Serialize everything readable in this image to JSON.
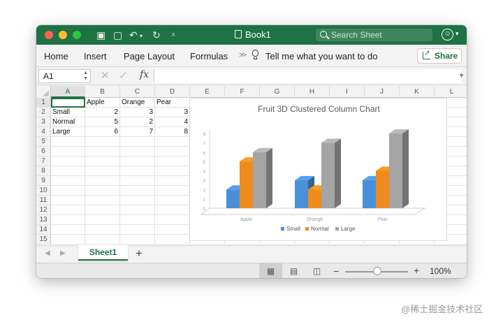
{
  "window": {
    "title": "Book1",
    "search_placeholder": "Search Sheet",
    "colors": {
      "accent": "#1f7244",
      "small": "#4a90d9",
      "normal": "#f08b1e",
      "large": "#a5a5a5"
    }
  },
  "ribbon": {
    "tabs": [
      "Home",
      "Insert",
      "Page Layout",
      "Formulas"
    ],
    "tell_me": "Tell me what you want to do",
    "share_label": "Share"
  },
  "formula_bar": {
    "name_box": "A1",
    "formula": "",
    "fx_label": "fx"
  },
  "columns": [
    "A",
    "B",
    "C",
    "D",
    "E",
    "F",
    "G",
    "H",
    "I",
    "J",
    "K",
    "L"
  ],
  "rows": [
    "1",
    "2",
    "3",
    "4",
    "5",
    "6",
    "7",
    "8",
    "9",
    "10",
    "11",
    "12",
    "13",
    "14",
    "15"
  ],
  "table": {
    "header": [
      "",
      "Apple",
      "Orange",
      "Pear"
    ],
    "rows": [
      [
        "Small",
        "2",
        "3",
        "3"
      ],
      [
        "Normal",
        "5",
        "2",
        "4"
      ],
      [
        "Large",
        "6",
        "7",
        "8"
      ]
    ]
  },
  "chart_data": {
    "type": "bar",
    "title": "Fruit 3D Clustered Column Chart",
    "categories": [
      "Apple",
      "Orange",
      "Pear"
    ],
    "series": [
      {
        "name": "Small",
        "values": [
          2,
          3,
          3
        ],
        "color": "#4a90d9"
      },
      {
        "name": "Normal",
        "values": [
          5,
          2,
          4
        ],
        "color": "#f08b1e"
      },
      {
        "name": "Large",
        "values": [
          6,
          7,
          8
        ],
        "color": "#a5a5a5"
      }
    ],
    "ylim": [
      0,
      8
    ],
    "yticks": [
      "0",
      "1",
      "2",
      "3",
      "4",
      "5",
      "6",
      "7",
      "8"
    ],
    "legend": "bottom"
  },
  "sheets": {
    "active": "Sheet1"
  },
  "status": {
    "zoom": "100%",
    "zoom_fraction": 0.5
  },
  "watermark": "@稀土掘金技术社区"
}
